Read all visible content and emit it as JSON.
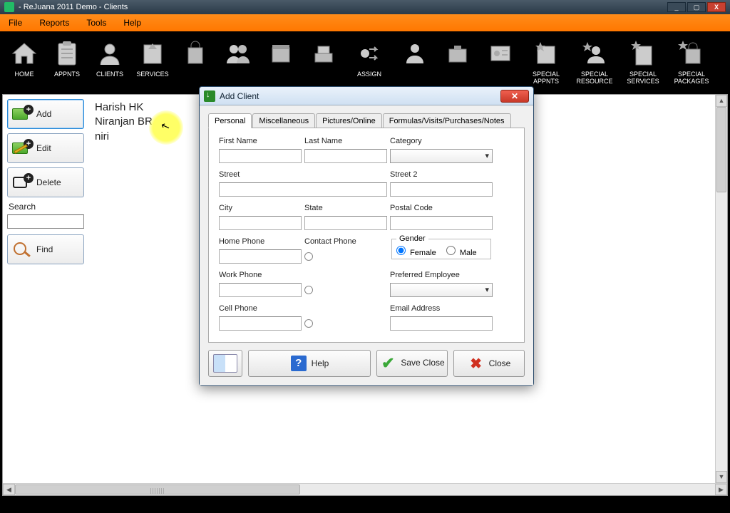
{
  "titlebar": {
    "text": " - ReJuana 2011 Demo - Clients"
  },
  "win_buttons": {
    "min": "_",
    "max": "▢",
    "close": "X"
  },
  "menu": [
    "File",
    "Reports",
    "Tools",
    "Help"
  ],
  "toolbar": [
    {
      "label": "HOME",
      "name": "home"
    },
    {
      "label": "APPNTS",
      "name": "appnts"
    },
    {
      "label": "CLIENTS",
      "name": "clients"
    },
    {
      "label": "SERVICES",
      "name": "services"
    },
    {
      "label": "",
      "name": "packages-cut"
    },
    {
      "label": "",
      "name": "employees-cut"
    },
    {
      "label": "",
      "name": "products-cut"
    },
    {
      "label": "",
      "name": "sales-cut"
    },
    {
      "label": "ASSIGN",
      "name": "assign",
      "dual": true
    },
    {
      "label": "",
      "name": "customer-cut"
    },
    {
      "label": "",
      "name": "supplier-cut"
    },
    {
      "label": "",
      "name": "receipt-cut"
    },
    {
      "label": "SPECIAL APPNTS",
      "name": "special-appnts",
      "dual": true
    },
    {
      "label": "SPECIAL RESOURCE",
      "name": "special-resource",
      "dual": true
    },
    {
      "label": "SPECIAL SERVICES",
      "name": "special-services",
      "dual": true
    },
    {
      "label": "SPECIAL PACKAGES",
      "name": "special-packages",
      "dual": true
    }
  ],
  "sidepanel": {
    "add": "Add",
    "edit": "Edit",
    "delete": "Delete",
    "search": "Search",
    "find": "Find",
    "search_value": ""
  },
  "clients": [
    "Harish HK",
    "Niranjan BR",
    "niri"
  ],
  "dialog": {
    "title": "Add Client",
    "tabs": [
      "Personal",
      "Miscellaneous",
      "Pictures/Online",
      "Formulas/Visits/Purchases/Notes"
    ],
    "fields": {
      "first_name": {
        "label": "First Name",
        "value": ""
      },
      "last_name": {
        "label": "Last Name",
        "value": ""
      },
      "category": {
        "label": "Category",
        "value": ""
      },
      "street": {
        "label": "Street",
        "value": ""
      },
      "street2": {
        "label": "Street 2",
        "value": ""
      },
      "city": {
        "label": "City",
        "value": ""
      },
      "state": {
        "label": "State",
        "value": ""
      },
      "postal_code": {
        "label": "Postal Code",
        "value": ""
      },
      "home_phone": {
        "label": "Home Phone",
        "value": ""
      },
      "contact_phone": {
        "label": "Contact Phone"
      },
      "work_phone": {
        "label": "Work Phone",
        "value": ""
      },
      "cell_phone": {
        "label": "Cell Phone",
        "value": ""
      },
      "gender": {
        "label": "Gender",
        "female": "Female",
        "male": "Male",
        "selected": "female"
      },
      "preferred_employee": {
        "label": "Preferred Employee",
        "value": ""
      },
      "email": {
        "label": "Email Address",
        "value": ""
      }
    },
    "buttons": {
      "help": "Help",
      "save": "Save Close",
      "close": "Close"
    }
  }
}
